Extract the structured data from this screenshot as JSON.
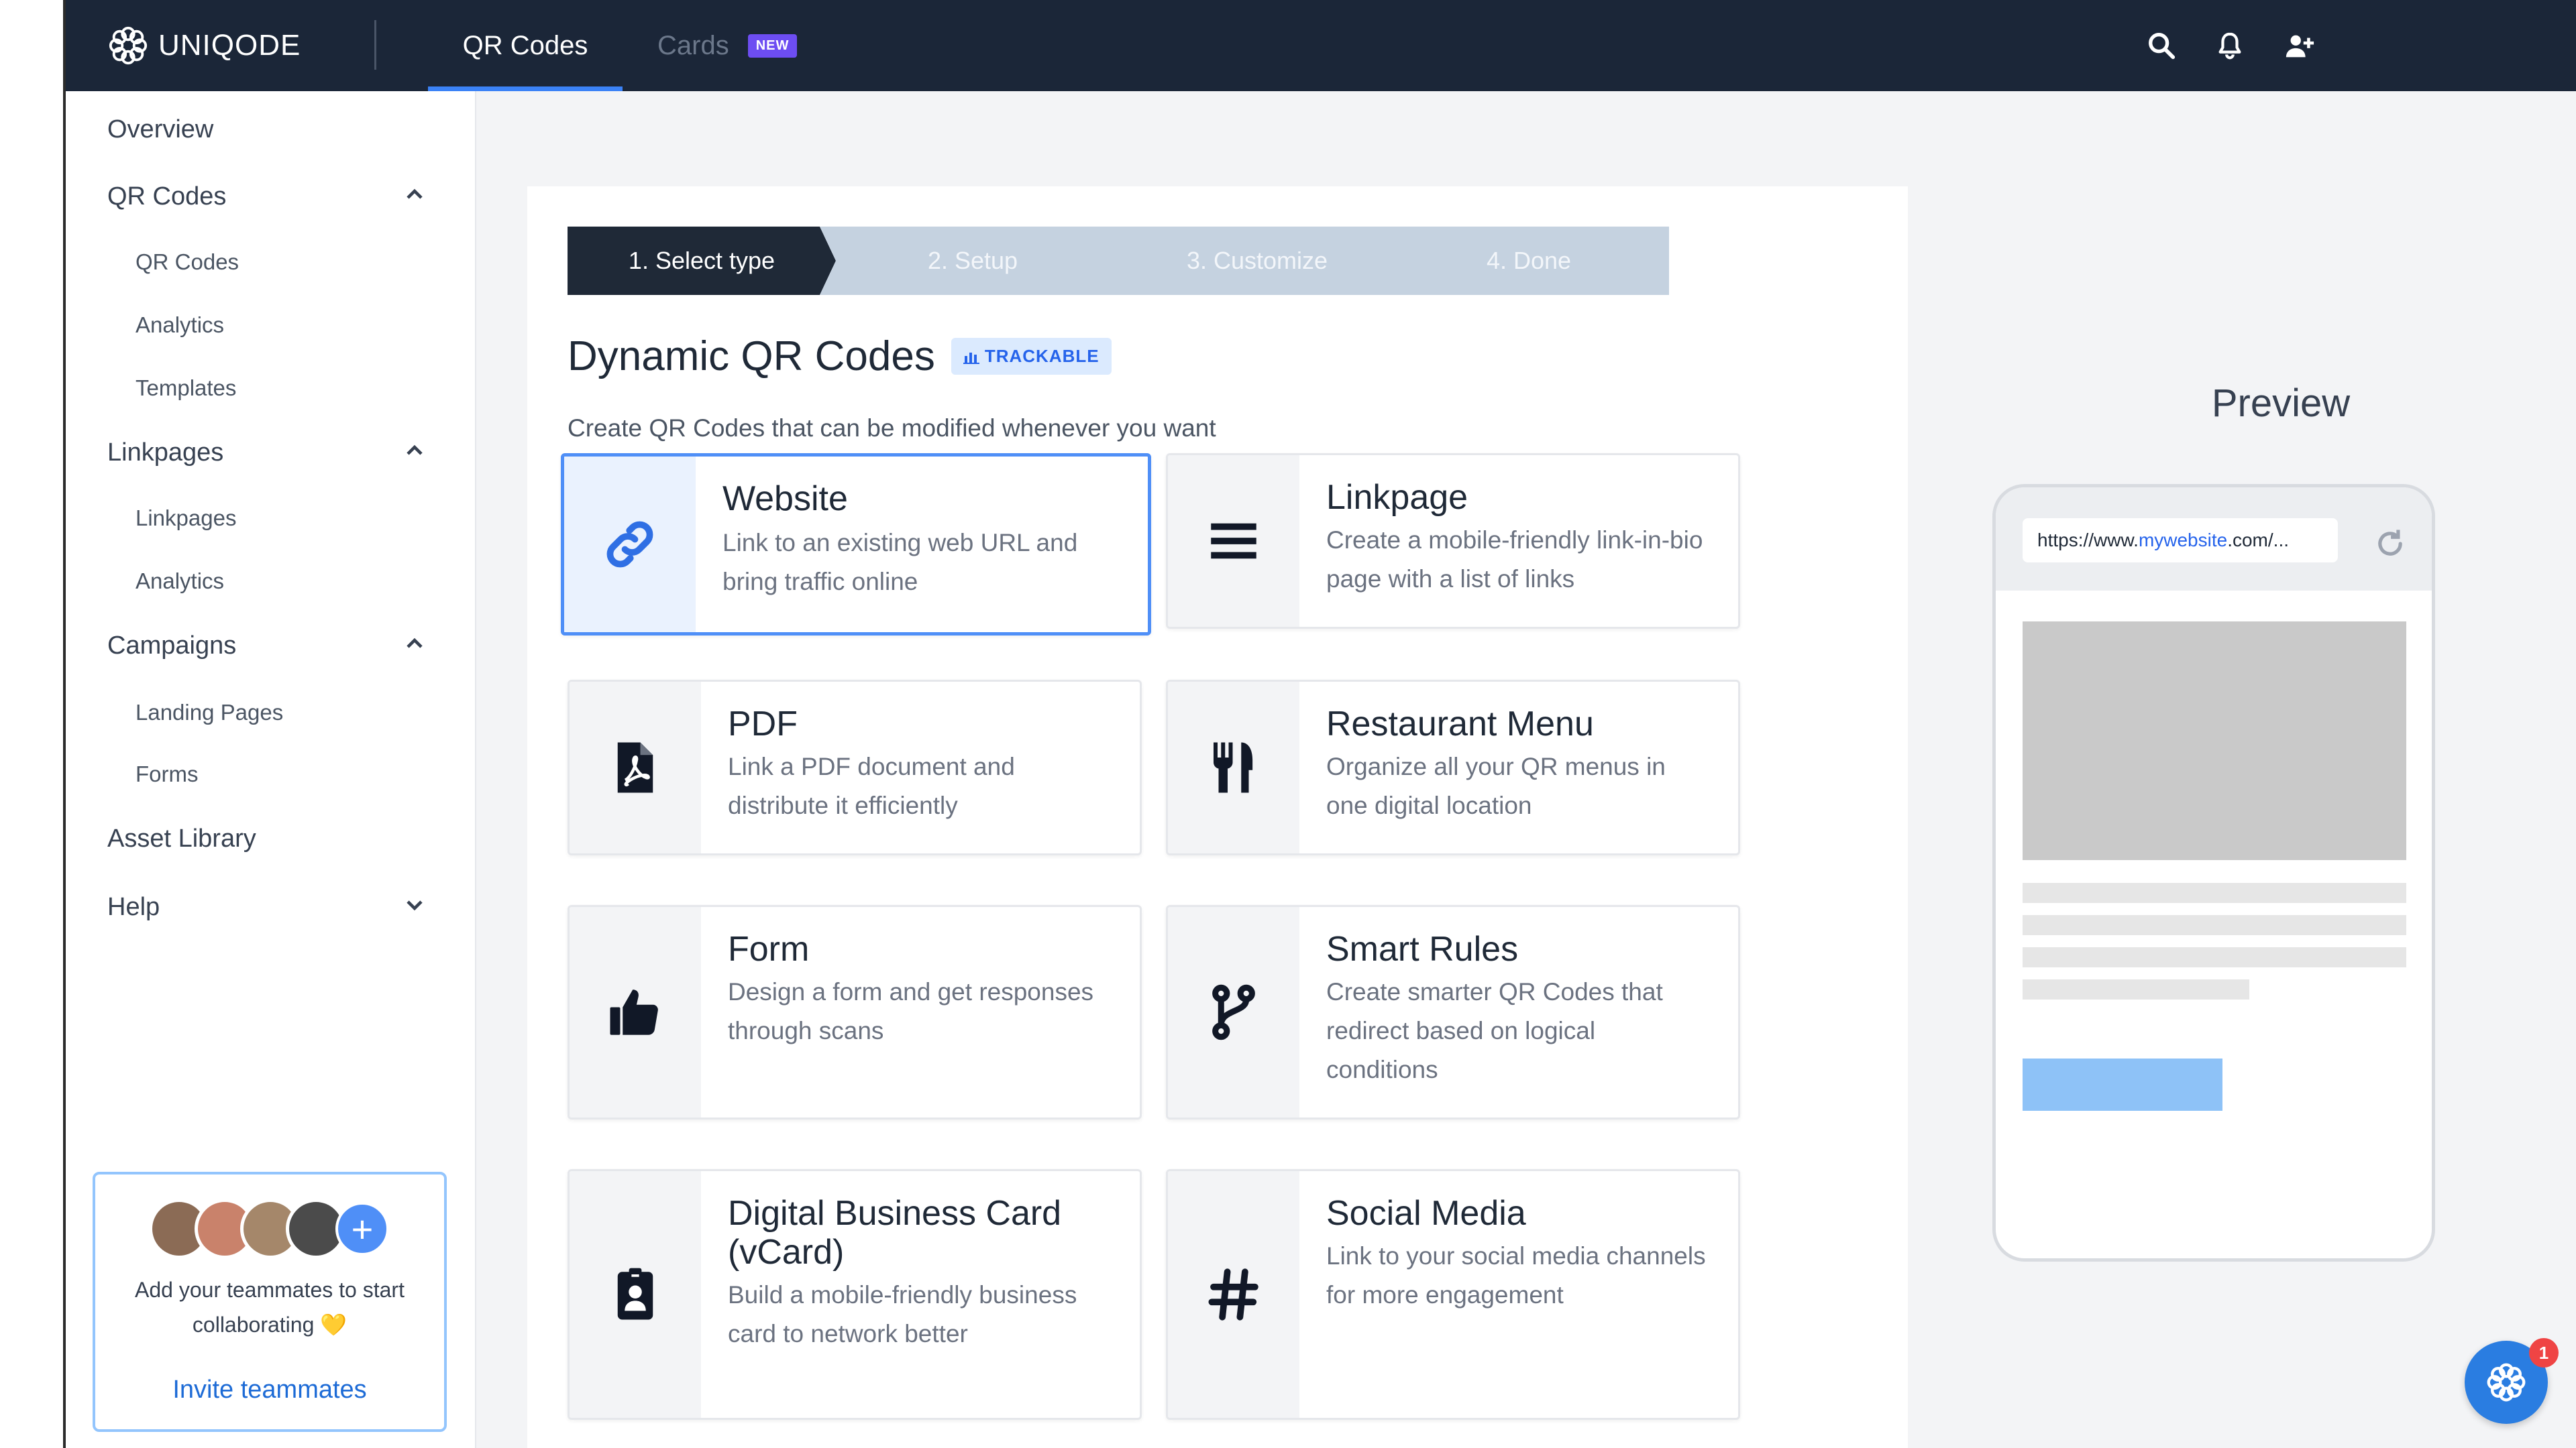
{
  "app": {
    "brand": "UNIQODE"
  },
  "topnav": {
    "tabs": [
      {
        "label": "QR Codes",
        "active": true
      },
      {
        "label": "Cards",
        "badge": "NEW"
      }
    ],
    "icons": [
      "search-icon",
      "bell-icon",
      "add-user-icon"
    ]
  },
  "sidebar": {
    "items": [
      {
        "label": "Overview"
      },
      {
        "label": "QR Codes",
        "expanded": true,
        "children": [
          "QR Codes",
          "Analytics",
          "Templates"
        ]
      },
      {
        "label": "Linkpages",
        "expanded": true,
        "children": [
          "Linkpages",
          "Analytics"
        ]
      },
      {
        "label": "Campaigns",
        "expanded": true,
        "children": [
          "Landing Pages",
          "Forms"
        ]
      },
      {
        "label": "Asset Library"
      },
      {
        "label": "Help",
        "expanded": false
      }
    ],
    "invite": {
      "text": "Add your teammates to start collaborating 💛",
      "link": "Invite teammates"
    }
  },
  "stepper": {
    "steps": [
      "1. Select type",
      "2. Setup",
      "3. Customize",
      "4. Done"
    ],
    "active_index": 0
  },
  "section": {
    "title": "Dynamic QR Codes",
    "badge": "TRACKABLE",
    "subtitle": "Create QR Codes that can be modified whenever you want"
  },
  "cards": [
    {
      "title": "Website",
      "desc": "Link to an existing web URL and bring traffic online",
      "icon": "link-icon",
      "selected": true
    },
    {
      "title": "Linkpage",
      "desc": "Create a mobile-friendly link-in-bio page with a list of links",
      "icon": "list-icon"
    },
    {
      "title": "PDF",
      "desc": "Link a PDF document and distribute it efficiently",
      "icon": "pdf-file-icon"
    },
    {
      "title": "Restaurant Menu",
      "desc": "Organize all your QR menus in one digital location",
      "icon": "fork-knife-icon"
    },
    {
      "title": "Form",
      "desc": "Design a form and get responses through scans",
      "icon": "thumbs-up-icon"
    },
    {
      "title": "Smart Rules",
      "desc": "Create smarter QR Codes that redirect based on logical conditions",
      "icon": "branch-icon"
    },
    {
      "title": "Digital Business Card (vCard)",
      "desc": "Build a mobile-friendly business card to network better",
      "icon": "id-badge-icon"
    },
    {
      "title": "Social Media",
      "desc": "Link to your social media channels for more engagement",
      "icon": "hashtag-icon"
    }
  ],
  "preview": {
    "title": "Preview",
    "url_prefix": "https://www.",
    "url_domain": "mywebsite",
    "url_suffix": ".com/..."
  },
  "chat": {
    "badge_count": "1"
  },
  "colors": {
    "topbar": "#1b2638",
    "accent": "#4f8ff7",
    "step_active": "#1f2937",
    "step_inactive": "#c5d2e0"
  }
}
